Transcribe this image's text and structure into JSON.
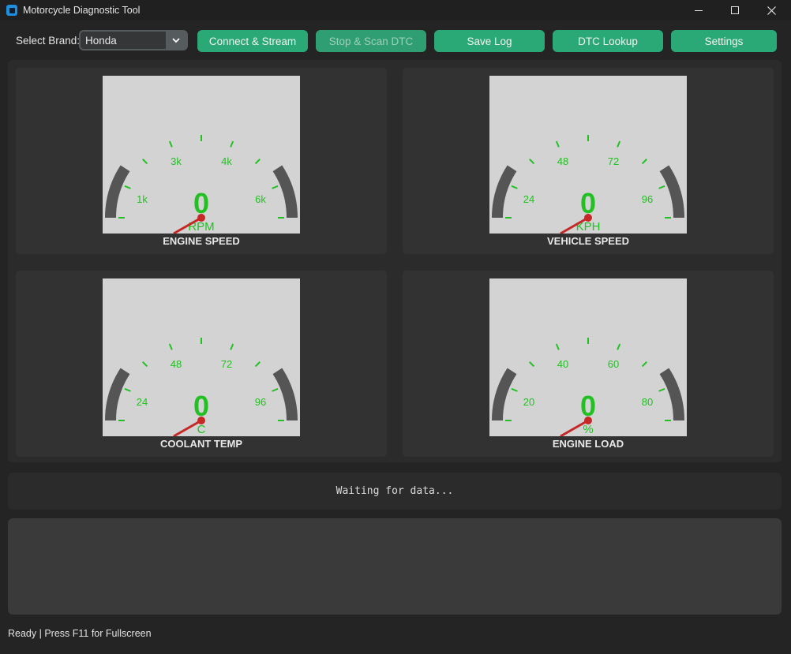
{
  "window": {
    "title": "Motorcycle Diagnostic Tool"
  },
  "toolbar": {
    "brand_label": "Select Brand:",
    "brand_value": "Honda",
    "buttons": [
      "Connect & Stream",
      "Stop & Scan DTC",
      "Save Log",
      "DTC Lookup",
      "Settings"
    ]
  },
  "gauges": [
    {
      "title": "ENGINE SPEED",
      "value": "0",
      "unit": "RPM",
      "ticks": [
        "1k",
        "3k",
        "4k",
        "6k"
      ]
    },
    {
      "title": "VEHICLE SPEED",
      "value": "0",
      "unit": "KPH",
      "ticks": [
        "24",
        "48",
        "72",
        "96"
      ]
    },
    {
      "title": "COOLANT TEMP",
      "value": "0",
      "unit": "C",
      "ticks": [
        "24",
        "48",
        "72",
        "96"
      ]
    },
    {
      "title": "ENGINE LOAD",
      "value": "0",
      "unit": "%",
      "ticks": [
        "20",
        "40",
        "60",
        "80"
      ]
    }
  ],
  "status_text": "Waiting for data...",
  "footer_text": "Ready | Press F11 for Fullscreen",
  "colors": {
    "accent": "#2aa876",
    "tick": "#22c022",
    "needle": "#c62828",
    "gauge_face": "#d3d3d3",
    "arc": "#555555"
  }
}
